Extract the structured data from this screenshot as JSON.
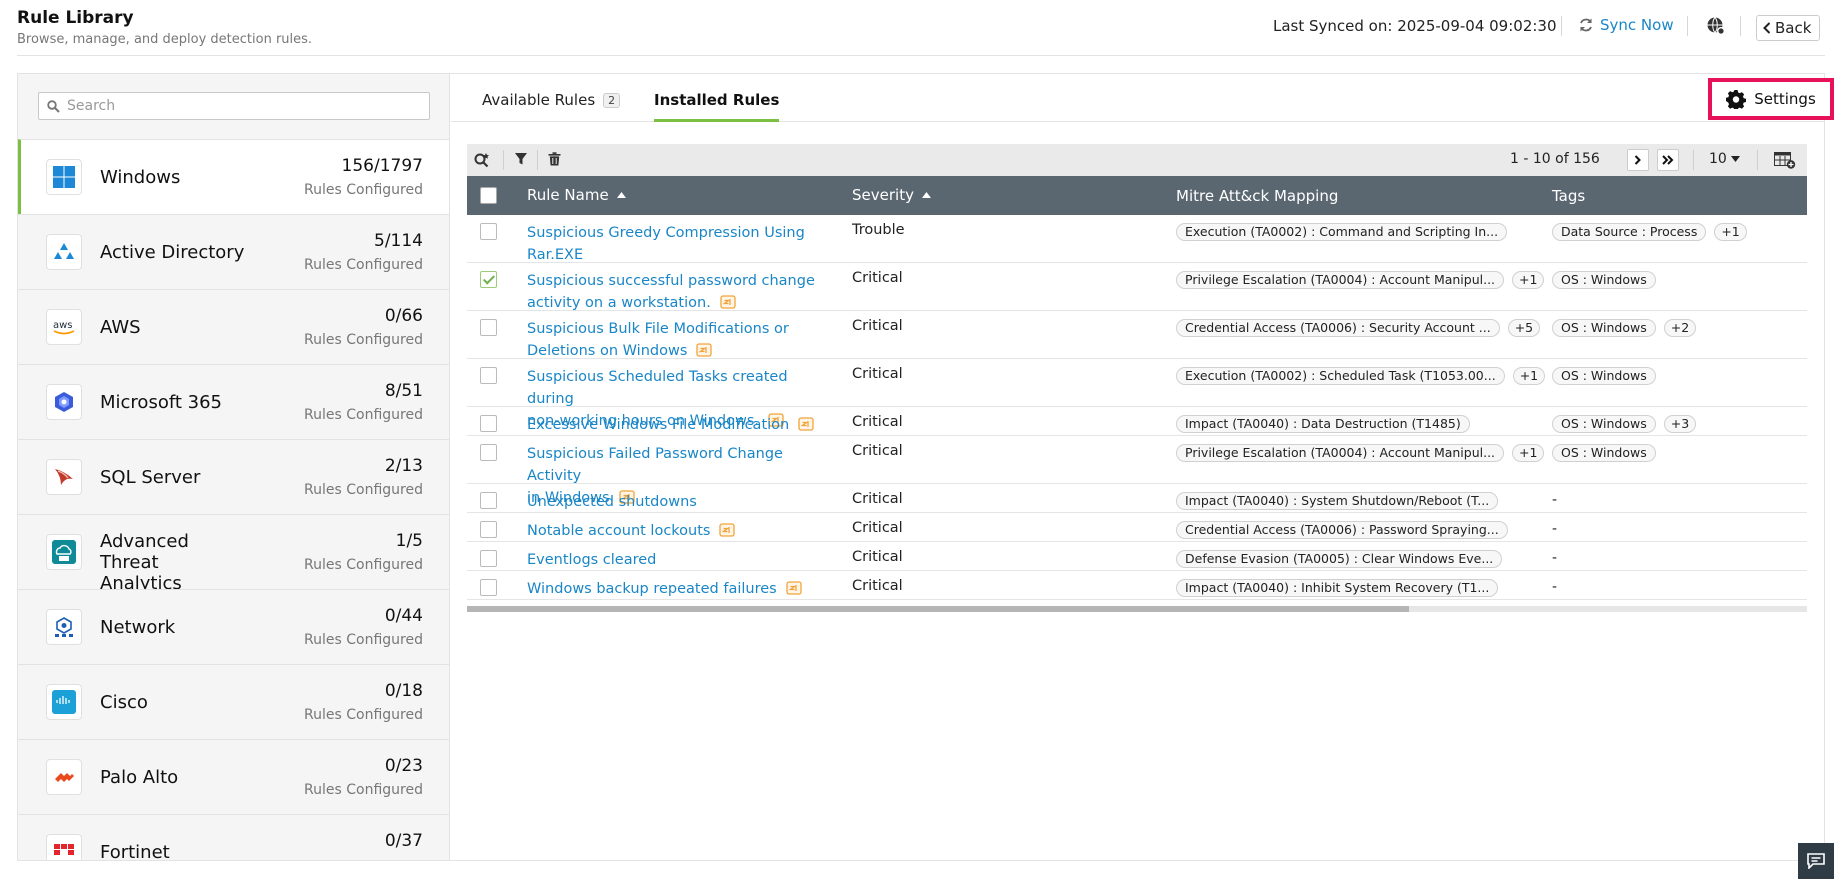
{
  "header": {
    "title": "Rule Library",
    "subtitle": "Browse, manage, and deploy detection rules.",
    "last_synced": "Last Synced on: 2025-09-04 09:02:30",
    "sync_now": "Sync Now",
    "back": "Back"
  },
  "sidebar": {
    "search_placeholder": "Search",
    "sub_label": "Rules Configured",
    "items": [
      {
        "name": "Windows",
        "count": "156/1797"
      },
      {
        "name": "Active Directory",
        "count": "5/114"
      },
      {
        "name": "AWS",
        "count": "0/66"
      },
      {
        "name": "Microsoft 365",
        "count": "8/51"
      },
      {
        "name": "SQL Server",
        "count": "2/13"
      },
      {
        "name": "Advanced Threat Analytics",
        "count": "1/5"
      },
      {
        "name": "Network",
        "count": "0/44"
      },
      {
        "name": "Cisco",
        "count": "0/18"
      },
      {
        "name": "Palo Alto",
        "count": "0/23"
      },
      {
        "name": "Fortinet",
        "count": "0/37"
      }
    ]
  },
  "tabs": {
    "available": "Available Rules",
    "available_badge": "2",
    "installed": "Installed Rules",
    "settings": "Settings"
  },
  "pager": {
    "range": "1 - 10 of 156",
    "per_page": "10"
  },
  "columns": {
    "rule_name": "Rule Name",
    "severity": "Severity",
    "mitre": "Mitre Att&ck Mapping",
    "tags": "Tags"
  },
  "rows": [
    {
      "name_l1": "Suspicious Greedy Compression Using",
      "name_l2": "Rar.EXE",
      "severity": "Trouble",
      "mitre": "Execution (TA0002) : Command and Scripting In...",
      "mitre_more": "",
      "tag": "Data Source : Process",
      "tag_more": "+1"
    },
    {
      "name_l1": "Suspicious successful password change",
      "name_l2": "activity on a workstation.",
      "severity": "Critical",
      "mitre": "Privilege Escalation (TA0004) : Account Manipul...",
      "mitre_more": "+1",
      "tag": "OS : Windows",
      "tag_more": ""
    },
    {
      "name_l1": "Suspicious Bulk File Modifications or",
      "name_l2": "Deletions on Windows",
      "severity": "Critical",
      "mitre": "Credential Access (TA0006) : Security Account ...",
      "mitre_more": "+5",
      "tag": "OS : Windows",
      "tag_more": "+2"
    },
    {
      "name_l1": "Suspicious Scheduled Tasks created during",
      "name_l2": "non-working hours on Windows.",
      "severity": "Critical",
      "mitre": "Execution (TA0002) : Scheduled Task (T1053.00...",
      "mitre_more": "+1",
      "tag": "OS : Windows",
      "tag_more": ""
    },
    {
      "name_l1": "Excessive Windows File Modification",
      "name_l2": "",
      "severity": "Critical",
      "mitre": "Impact (TA0040) : Data Destruction (T1485)",
      "mitre_more": "",
      "tag": "OS : Windows",
      "tag_more": "+3"
    },
    {
      "name_l1": "Suspicious Failed Password Change Activity",
      "name_l2": "in Windows",
      "severity": "Critical",
      "mitre": "Privilege Escalation (TA0004) : Account Manipul...",
      "mitre_more": "+1",
      "tag": "OS : Windows",
      "tag_more": ""
    },
    {
      "name_l1": "Unexpected shutdowns",
      "name_l2": "",
      "severity": "Critical",
      "mitre": "Impact (TA0040) : System Shutdown/Reboot (T...",
      "mitre_more": "",
      "tag": "-",
      "tag_more": ""
    },
    {
      "name_l1": "Notable account lockouts",
      "name_l2": "",
      "severity": "Critical",
      "mitre": "Credential Access (TA0006) : Password Spraying...",
      "mitre_more": "",
      "tag": "-",
      "tag_more": ""
    },
    {
      "name_l1": "Eventlogs cleared",
      "name_l2": "",
      "severity": "Critical",
      "mitre": "Defense Evasion (TA0005) : Clear Windows Eve...",
      "mitre_more": "",
      "tag": "-",
      "tag_more": ""
    },
    {
      "name_l1": "Windows backup repeated failures",
      "name_l2": "",
      "severity": "Critical",
      "mitre": "Impact (TA0040) : Inhibit System Recovery (T1...",
      "mitre_more": "",
      "tag": "-",
      "tag_more": ""
    }
  ]
}
